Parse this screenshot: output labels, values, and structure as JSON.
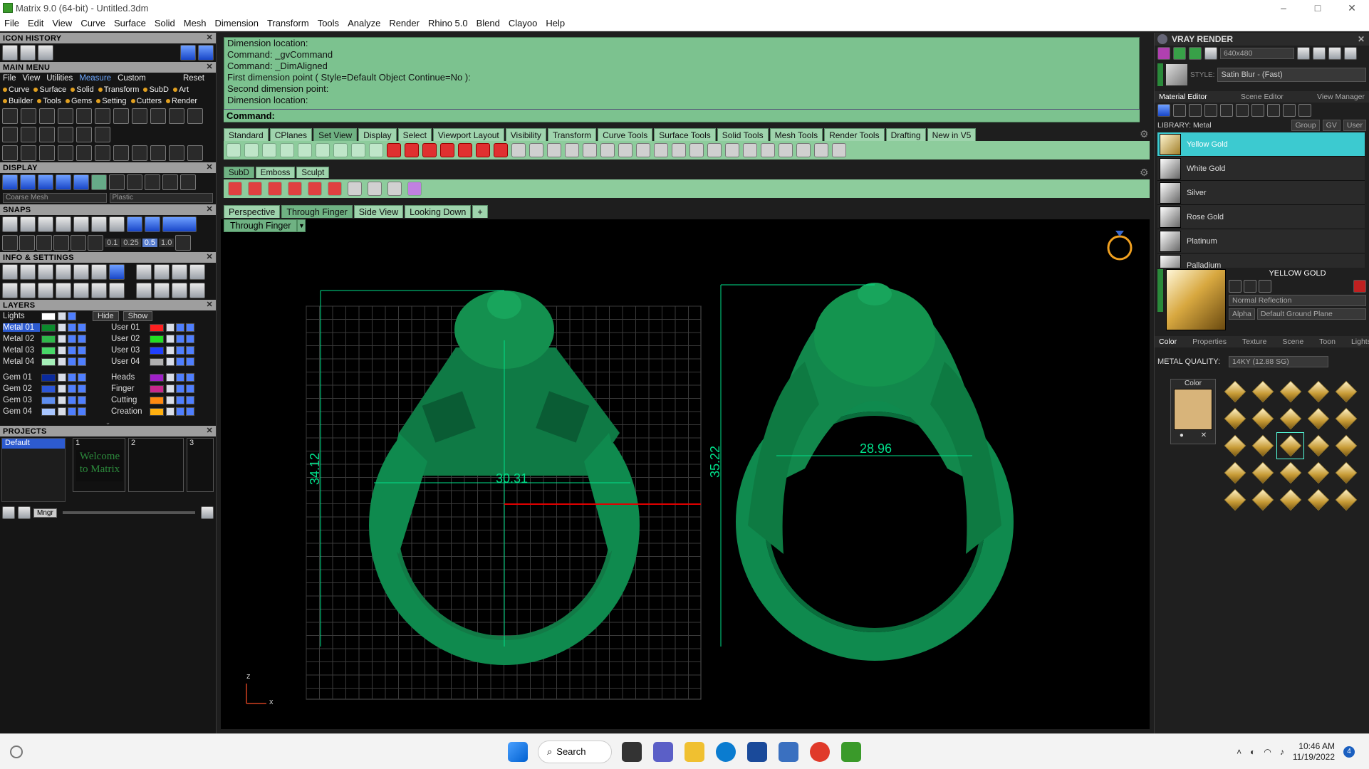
{
  "window": {
    "title": "Matrix 9.0 (64-bit) - Untitled.3dm",
    "minimize": "–",
    "maximize": "□",
    "close": "✕"
  },
  "menubar": [
    "File",
    "Edit",
    "View",
    "Curve",
    "Surface",
    "Solid",
    "Mesh",
    "Dimension",
    "Transform",
    "Tools",
    "Analyze",
    "Render",
    "Rhino 5.0",
    "Blend",
    "Clayoo",
    "Help"
  ],
  "left": {
    "icon_history": "ICON HISTORY",
    "main_menu": "MAIN MENU",
    "mm_row1": [
      "File",
      "View",
      "Utilities",
      "Measure",
      "Custom",
      "Reset"
    ],
    "mm_row2": [
      "Curve",
      "Surface",
      "Solid",
      "Transform",
      "SubD",
      "Art"
    ],
    "mm_row3": [
      "Builder",
      "Tools",
      "Gems",
      "Setting",
      "Cutters",
      "Render"
    ],
    "display": "DISPLAY",
    "display_mesh": "Coarse Mesh",
    "display_material": "Plastic",
    "snaps": "SNAPS",
    "snap_vals": [
      "0.1",
      "0.25",
      "0.5",
      "1.0"
    ],
    "info": "INFO & SETTINGS",
    "layers": "LAYERS",
    "lights": "Lights",
    "hide": "Hide",
    "show": "Show",
    "layer_left": [
      "Metal 01",
      "Metal 02",
      "Metal 03",
      "Metal 04",
      "Gem 01",
      "Gem 02",
      "Gem 03",
      "Gem 04"
    ],
    "layer_left_colors": [
      "#0b8a2c",
      "#2fb84a",
      "#48d868",
      "#a5f0b8",
      "#0a2a9c",
      "#2c56d8",
      "#5e8ef0",
      "#a8c6ff"
    ],
    "layer_right": [
      "User 01",
      "User 02",
      "User 03",
      "User 04",
      "Heads",
      "Finger",
      "Cutting",
      "Creation"
    ],
    "layer_right_colors": [
      "#ff2020",
      "#22e022",
      "#2040ff",
      "#b0b0b0",
      "#a020c8",
      "#c8288c",
      "#ff8a10",
      "#ffb010"
    ],
    "projects": "PROJECTS",
    "project_default": "Default",
    "slot1": "1",
    "slot2": "2",
    "slot3": "3",
    "welcome": "Welcome to Matrix",
    "mngr": "Mngr"
  },
  "command": {
    "lines": [
      "Dimension location:",
      "Command: _gvCommand",
      "Command: _DimAligned",
      "First dimension point ( Style=Default  Object  Continue=No ):",
      "Second dimension point:",
      "Dimension location:"
    ],
    "prompt": "Command:"
  },
  "toolbar_tabs": [
    "Standard",
    "CPlanes",
    "Set View",
    "Display",
    "Select",
    "Viewport Layout",
    "Visibility",
    "Transform",
    "Curve Tools",
    "Surface Tools",
    "Solid Tools",
    "Mesh Tools",
    "Render Tools",
    "Drafting",
    "New in V5"
  ],
  "toolbar_tabs_active": "Set View",
  "subd_tabs": [
    "SubD",
    "Emboss",
    "Sculpt"
  ],
  "viewport_tabs": [
    "Perspective",
    "Through Finger",
    "Side View",
    "Looking Down",
    "+"
  ],
  "viewport_active": "Through Finger",
  "viewport_label": "Through Finger",
  "dims": {
    "d1": "30.31",
    "d2": "34.12",
    "d3": "28.96",
    "d4": "35.22"
  },
  "axis": {
    "z": "z",
    "x": "x"
  },
  "right": {
    "vray_title": "VRAY RENDER",
    "resolution": "640x480",
    "style_label": "STYLE:",
    "style_value": "Satin Blur - (Fast)",
    "tabs": [
      "Material Editor",
      "Scene Editor",
      "View Manager"
    ],
    "library": "LIBRARY: Metal",
    "group": "Group",
    "gv": "GV",
    "user": "User",
    "materials": [
      "Yellow Gold",
      "White Gold",
      "Silver",
      "Rose Gold",
      "Platinum",
      "Palladium"
    ],
    "selected_title": "YELLOW GOLD",
    "reflection": "Normal Reflection",
    "alpha": "Alpha",
    "ground": "Default Ground Plane",
    "subtabs": [
      "Color",
      "Properties",
      "Texture",
      "Scene",
      "Toon",
      "Lights"
    ],
    "metal_quality_label": "METAL QUALITY:",
    "metal_quality_value": "14KY       (12.88 SG)",
    "color_label": "Color",
    "swatch_color": "#d8b47a"
  },
  "taskbar": {
    "search": "Search",
    "time": "10:46 AM",
    "date": "11/19/2022",
    "badge": "4"
  }
}
